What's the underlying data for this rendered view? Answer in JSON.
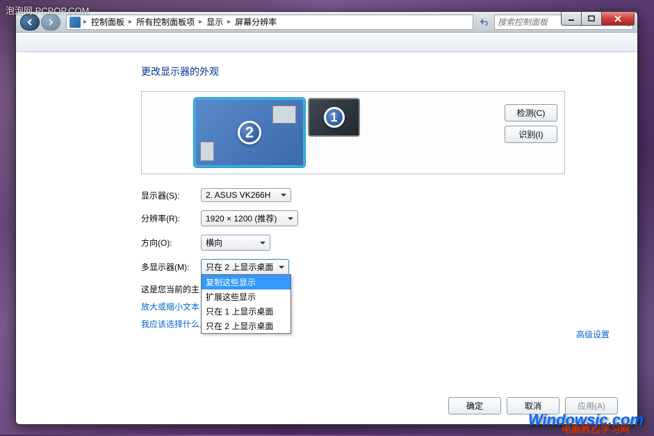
{
  "watermarks": {
    "top": "泡泡网 PCPOP.COM",
    "bottom1": "Windowsjc.com",
    "bottom2": "电脑教程学习网"
  },
  "breadcrumb": {
    "items": [
      "控制面板",
      "所有控制面板项",
      "显示",
      "屏幕分辨率"
    ]
  },
  "search": {
    "placeholder": "搜索控制面板"
  },
  "page": {
    "title": "更改显示器的外观",
    "detect": "检测(C)",
    "identify": "识别(I)",
    "monitor2_num": "2",
    "monitor1_num": "1"
  },
  "form": {
    "display_label": "显示器(S):",
    "display_value": "2. ASUS VK266H",
    "resolution_label": "分辨率(R):",
    "resolution_value": "1920 × 1200 (推荐)",
    "orientation_label": "方向(O):",
    "orientation_value": "横向",
    "multi_label": "多显示器(M):",
    "multi_value": "只在 2 上显示桌面",
    "multi_options": [
      "复制这些显示",
      "扩展这些显示",
      "只在 1 上显示桌面",
      "只在 2 上显示桌面"
    ]
  },
  "info": {
    "primary_text": "这是您当前的主",
    "text_link": "放大或缩小文本",
    "help_link": "我应该选择什么显示器设置？",
    "advanced": "高级设置"
  },
  "buttons": {
    "ok": "确定",
    "cancel": "取消",
    "apply": "应用(A)"
  }
}
